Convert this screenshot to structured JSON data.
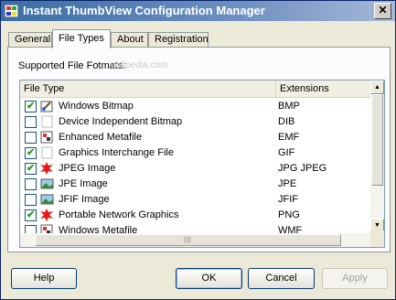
{
  "window": {
    "title": "Instant ThumbView Configuration Manager",
    "close_label": "✕"
  },
  "tabs": [
    {
      "label": "General",
      "active": false
    },
    {
      "label": "File Types",
      "active": true
    },
    {
      "label": "About",
      "active": false
    },
    {
      "label": "Registration",
      "active": false
    }
  ],
  "panel": {
    "section_label": "Supported File Fotmats:",
    "watermark": "softpedia.com"
  },
  "list": {
    "columns": [
      "File Type",
      "Extensions"
    ],
    "rows": [
      {
        "name": "Windows Bitmap",
        "ext": "BMP",
        "checked": true,
        "icon": "paint-brush-icon"
      },
      {
        "name": "Device Independent Bitmap",
        "ext": "DIB",
        "checked": false,
        "icon": "blank-file-icon"
      },
      {
        "name": "Enhanced Metafile",
        "ext": "EMF",
        "checked": false,
        "icon": "metafile-icon"
      },
      {
        "name": "Graphics Interchange File",
        "ext": "GIF",
        "checked": true,
        "icon": "blank-file-icon"
      },
      {
        "name": "JPEG Image",
        "ext": "JPG  JPEG",
        "checked": true,
        "icon": "red-splat-icon"
      },
      {
        "name": "JPE Image",
        "ext": "JPE",
        "checked": false,
        "icon": "landscape-image-icon"
      },
      {
        "name": "JFIF Image",
        "ext": "JFIF",
        "checked": false,
        "icon": "landscape-image-icon"
      },
      {
        "name": "Portable Network Graphics",
        "ext": "PNG",
        "checked": true,
        "icon": "red-splat-icon"
      },
      {
        "name": "Windows Metafile",
        "ext": "WMF",
        "checked": false,
        "icon": "metafile-icon"
      }
    ]
  },
  "buttons": {
    "help": "Help",
    "ok": "OK",
    "cancel": "Cancel",
    "apply": "Apply"
  },
  "check_glyph": "✔",
  "scroll": {
    "up": "▲",
    "down": "▼",
    "grip": "|||"
  },
  "colors": {
    "titlebar": "#3a6ea5",
    "check": "#21a121",
    "splat": "#e31b1b"
  }
}
